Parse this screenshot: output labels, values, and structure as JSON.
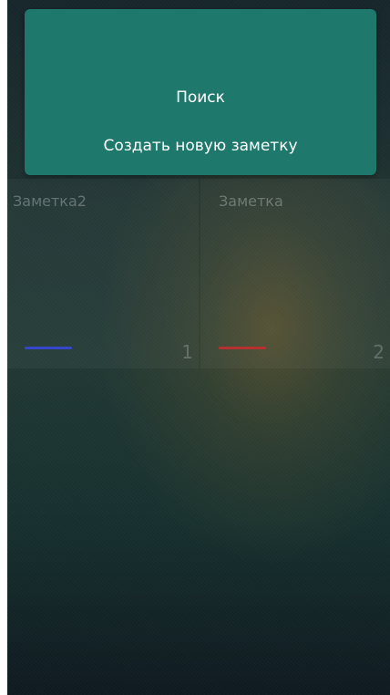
{
  "menu": {
    "items": [
      {
        "label": "Поиск"
      },
      {
        "label": "Создать новую заметку"
      }
    ]
  },
  "notes": [
    {
      "title": "Заметка2",
      "number": "1",
      "color": "#3346c8"
    },
    {
      "title": "Заметка",
      "number": "2",
      "color": "#b5302f"
    }
  ],
  "colors": {
    "menu_background": "#1f786c",
    "app_background": "#1f3331"
  }
}
